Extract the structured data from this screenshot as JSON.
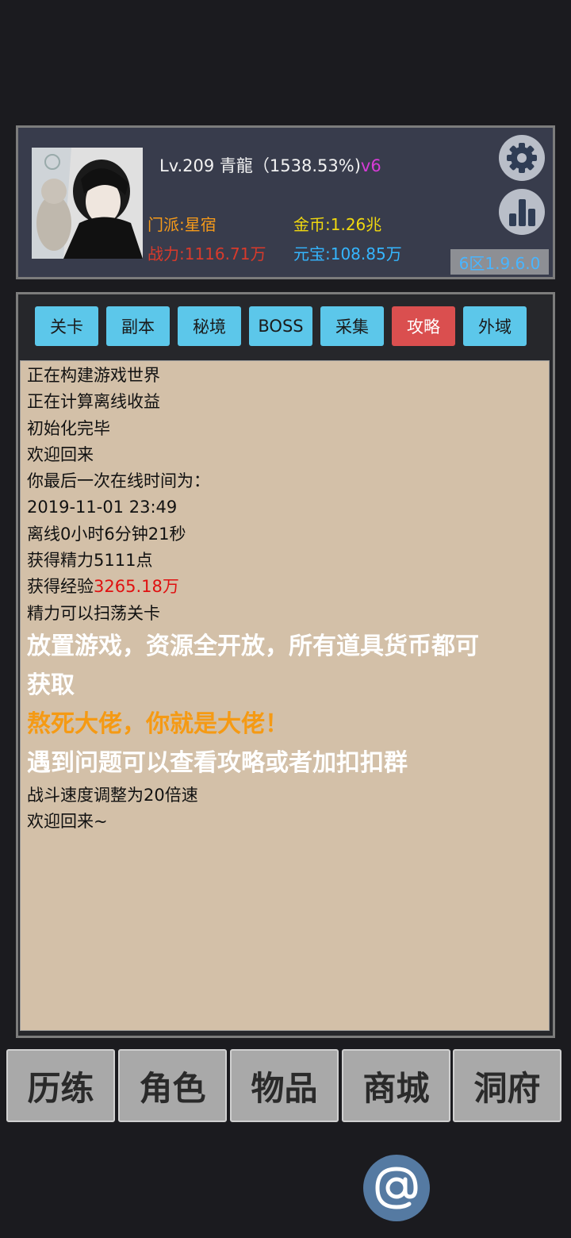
{
  "header": {
    "level": "Lv.209 青龍（1538.53%)",
    "vip": "v6",
    "sect": "门派:星宿",
    "gold": "金币:1.26兆",
    "power": "战力:1116.71万",
    "ingot": "元宝:108.85万",
    "server": "6区1.9.6.0"
  },
  "tabs": [
    {
      "label": "关卡"
    },
    {
      "label": "副本"
    },
    {
      "label": "秘境"
    },
    {
      "label": "BOSS"
    },
    {
      "label": "采集"
    },
    {
      "label": "攻略"
    },
    {
      "label": "外域"
    }
  ],
  "log": {
    "lines_a": [
      "正在构建游戏世界",
      "正在计算离线收益",
      "初始化完毕",
      "欢迎回来",
      "你最后一次在线时间为：",
      "2019-11-01 23:49",
      "离线0小时6分钟21秒",
      "获得精力5111点"
    ],
    "exp_prefix": "获得经验",
    "exp_value": "3265.18万",
    "line_sweep": "精力可以扫荡关卡",
    "big1a": "放置游戏，资源全开放，所有道具货币都可",
    "big1b": "获取",
    "orange": "熬死大佬，你就是大佬！",
    "big2": "遇到问题可以查看攻略或者加扣扣群",
    "speed": "战斗速度调整为20倍速",
    "welcome": "欢迎回来~"
  },
  "nav": [
    {
      "label": "历练"
    },
    {
      "label": "角色"
    },
    {
      "label": "物品"
    },
    {
      "label": "商城"
    },
    {
      "label": "洞府"
    }
  ],
  "icons": {
    "settings": "gear-icon",
    "stats": "bar-chart-icon",
    "at": "at-sign-icon"
  },
  "colors": {
    "tab": "#5cc7ea",
    "tab_active": "#da4f4f",
    "log_bg": "#d3c0a8",
    "gold": "#f0d80f",
    "power": "#d83a2b",
    "ingot": "#35b6ff",
    "sect": "#f59a1a"
  }
}
